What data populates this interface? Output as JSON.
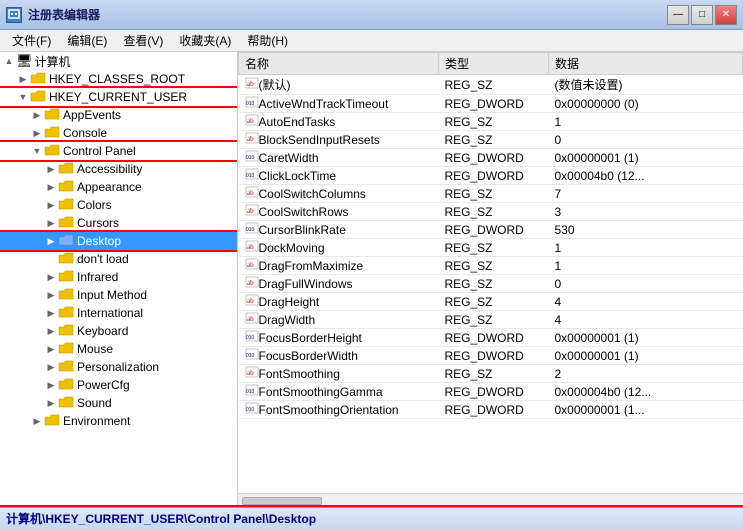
{
  "window": {
    "title": "注册表编辑器",
    "icon": "regedit"
  },
  "menu": {
    "items": [
      "文件(F)",
      "编辑(E)",
      "查看(V)",
      "收藏夹(A)",
      "帮助(H)"
    ]
  },
  "tree": {
    "items": [
      {
        "id": "computer",
        "label": "计算机",
        "indent": 0,
        "type": "computer",
        "expanded": true,
        "expand": "▲"
      },
      {
        "id": "hkcr",
        "label": "HKEY_CLASSES_ROOT",
        "indent": 1,
        "type": "folder",
        "expanded": false,
        "expand": "▶"
      },
      {
        "id": "hkcu",
        "label": "HKEY_CURRENT_USER",
        "indent": 1,
        "type": "folder",
        "expanded": true,
        "expand": "▼",
        "highlight": true
      },
      {
        "id": "appevents",
        "label": "AppEvents",
        "indent": 2,
        "type": "folder",
        "expanded": false,
        "expand": "▶"
      },
      {
        "id": "console",
        "label": "Console",
        "indent": 2,
        "type": "folder",
        "expanded": false,
        "expand": "▶"
      },
      {
        "id": "controlpanel",
        "label": "Control Panel",
        "indent": 2,
        "type": "folder",
        "expanded": true,
        "expand": "▼",
        "highlight": true
      },
      {
        "id": "accessibility",
        "label": "Accessibility",
        "indent": 3,
        "type": "folder",
        "expanded": false,
        "expand": "▶"
      },
      {
        "id": "appearance",
        "label": "Appearance",
        "indent": 3,
        "type": "folder",
        "expanded": false,
        "expand": "▶"
      },
      {
        "id": "colors",
        "label": "Colors",
        "indent": 3,
        "type": "folder",
        "expanded": false,
        "expand": "▶"
      },
      {
        "id": "cursors",
        "label": "Cursors",
        "indent": 3,
        "type": "folder",
        "expanded": false,
        "expand": "▶"
      },
      {
        "id": "desktop",
        "label": "Desktop",
        "indent": 3,
        "type": "folder",
        "expanded": false,
        "expand": "▶",
        "selected": true,
        "highlight": true
      },
      {
        "id": "dontload",
        "label": "don't load",
        "indent": 3,
        "type": "folder",
        "expanded": false,
        "expand": ""
      },
      {
        "id": "infrared",
        "label": "Infrared",
        "indent": 3,
        "type": "folder",
        "expanded": false,
        "expand": "▶"
      },
      {
        "id": "inputmethod",
        "label": "Input Method",
        "indent": 3,
        "type": "folder",
        "expanded": false,
        "expand": "▶"
      },
      {
        "id": "international",
        "label": "International",
        "indent": 3,
        "type": "folder",
        "expanded": false,
        "expand": "▶"
      },
      {
        "id": "keyboard",
        "label": "Keyboard",
        "indent": 3,
        "type": "folder",
        "expanded": false,
        "expand": "▶"
      },
      {
        "id": "mouse",
        "label": "Mouse",
        "indent": 3,
        "type": "folder",
        "expanded": false,
        "expand": "▶"
      },
      {
        "id": "personalization",
        "label": "Personalization",
        "indent": 3,
        "type": "folder",
        "expanded": false,
        "expand": "▶"
      },
      {
        "id": "powercfg",
        "label": "PowerCfg",
        "indent": 3,
        "type": "folder",
        "expanded": false,
        "expand": "▶"
      },
      {
        "id": "sound",
        "label": "Sound",
        "indent": 3,
        "type": "folder",
        "expanded": false,
        "expand": "▶"
      },
      {
        "id": "environment",
        "label": "Environment",
        "indent": 2,
        "type": "folder",
        "expanded": false,
        "expand": "▶"
      }
    ]
  },
  "table": {
    "columns": [
      "名称",
      "类型",
      "数据"
    ],
    "rows": [
      {
        "icon": "ab",
        "name": "(默认)",
        "type": "REG_SZ",
        "data": "(数值未设置)"
      },
      {
        "icon": "dword",
        "name": "ActiveWndTrackTimeout",
        "type": "REG_DWORD",
        "data": "0x00000000 (0)"
      },
      {
        "icon": "ab",
        "name": "AutoEndTasks",
        "type": "REG_SZ",
        "data": "1"
      },
      {
        "icon": "ab",
        "name": "BlockSendInputResets",
        "type": "REG_SZ",
        "data": "0"
      },
      {
        "icon": "dword",
        "name": "CaretWidth",
        "type": "REG_DWORD",
        "data": "0x00000001 (1)"
      },
      {
        "icon": "dword",
        "name": "ClickLockTime",
        "type": "REG_DWORD",
        "data": "0x00004b0 (12..."
      },
      {
        "icon": "ab",
        "name": "CoolSwitchColumns",
        "type": "REG_SZ",
        "data": "7"
      },
      {
        "icon": "ab",
        "name": "CoolSwitchRows",
        "type": "REG_SZ",
        "data": "3"
      },
      {
        "icon": "dword",
        "name": "CursorBlinkRate",
        "type": "REG_DWORD",
        "data": "530"
      },
      {
        "icon": "ab",
        "name": "DockMoving",
        "type": "REG_SZ",
        "data": "1"
      },
      {
        "icon": "ab",
        "name": "DragFromMaximize",
        "type": "REG_SZ",
        "data": "1"
      },
      {
        "icon": "ab",
        "name": "DragFullWindows",
        "type": "REG_SZ",
        "data": "0"
      },
      {
        "icon": "ab",
        "name": "DragHeight",
        "type": "REG_SZ",
        "data": "4"
      },
      {
        "icon": "ab",
        "name": "DragWidth",
        "type": "REG_SZ",
        "data": "4"
      },
      {
        "icon": "dword",
        "name": "FocusBorderHeight",
        "type": "REG_DWORD",
        "data": "0x00000001 (1)"
      },
      {
        "icon": "dword",
        "name": "FocusBorderWidth",
        "type": "REG_DWORD",
        "data": "0x00000001 (1)"
      },
      {
        "icon": "ab",
        "name": "FontSmoothing",
        "type": "REG_SZ",
        "data": "2"
      },
      {
        "icon": "dword",
        "name": "FontSmoothingGamma",
        "type": "REG_DWORD",
        "data": "0x000004b0 (12..."
      },
      {
        "icon": "dword",
        "name": "FontSmoothingOrientation",
        "type": "REG_DWORD",
        "data": "0x00000001 (1..."
      }
    ]
  },
  "statusbar": {
    "path": "计算机\\HKEY_CURRENT_USER\\Control Panel\\Desktop"
  }
}
